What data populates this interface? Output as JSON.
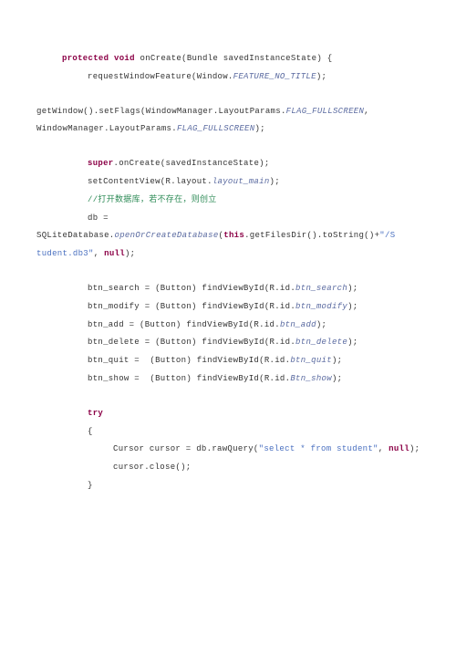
{
  "code": {
    "l1_kw1": "protected",
    "l1_kw2": "void",
    "l1_rest": " onCreate(Bundle savedInstanceState) {",
    "l2_a": "requestWindowFeature(Window.",
    "l2_b": "FEATURE_NO_TITLE",
    "l2_c": ");",
    "l3_a": "getWindow().setFlags(WindowManager.LayoutParams.",
    "l3_b": "FLAG_FULLSCREEN",
    "l3_c": ",",
    "l4_a": "WindowManager.LayoutParams.",
    "l4_b": "FLAG_FULLSCREEN",
    "l4_c": ");",
    "l5_kw": "super",
    "l5_rest": ".onCreate(savedInstanceState);",
    "l6_a": "setContentView(R.layout.",
    "l6_b": "layout_main",
    "l6_c": ");",
    "l7": "//打开数据库，若不存在，则创立",
    "l8": "db =",
    "l9_a": "SQLiteDatabase.",
    "l9_b": "openOrCreateDatabase",
    "l9_c": "(",
    "l9_d": "this",
    "l9_e": ".getFilesDir().toString()+",
    "l9_f": "\"/S",
    "l10_a": "tudent.db3\"",
    "l10_b": ", ",
    "l10_c": "null",
    "l10_d": ");",
    "l11_a": "btn_search = (Button) findViewById(R.id.",
    "l11_b": "btn_search",
    "l11_c": ");",
    "l12_a": "btn_modify = (Button) findViewById(R.id.",
    "l12_b": "btn_modify",
    "l12_c": ");",
    "l13_a": "btn_add = (Button) findViewById(R.id.",
    "l13_b": "btn_add",
    "l13_c": ");",
    "l14_a": "btn_delete = (Button) findViewById(R.id.",
    "l14_b": "btn_delete",
    "l14_c": ");",
    "l15_a": "btn_quit =  (Button) findViewById(R.id.",
    "l15_b": "btn_quit",
    "l15_c": ");",
    "l16_a": "btn_show =  (Button) findViewById(R.id.",
    "l16_b": "Btn_show",
    "l16_c": ");",
    "l17": "try",
    "l18": "{",
    "l19_a": "Cursor cursor = db.rawQuery(",
    "l19_b": "\"select * from student\"",
    "l19_c": ", ",
    "l19_d": "null",
    "l19_e": ");",
    "l20": "cursor.close();",
    "l21": "}"
  }
}
